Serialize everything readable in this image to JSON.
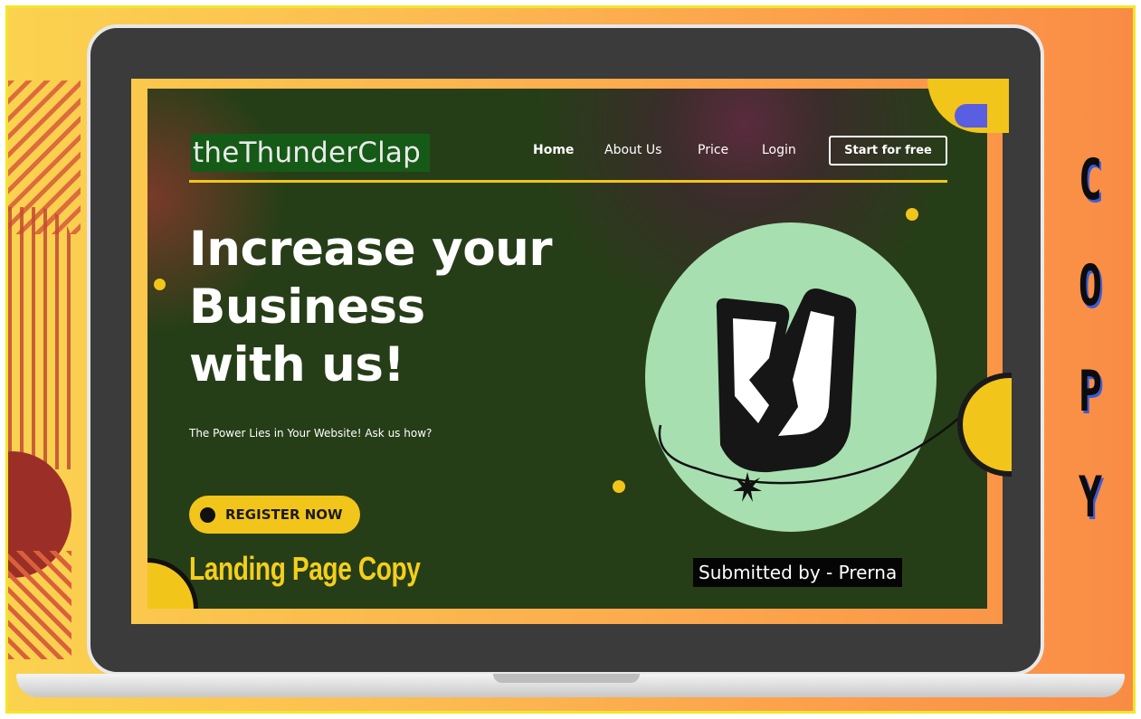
{
  "brand": {
    "logo_text": "theThunderClap"
  },
  "nav": {
    "items": [
      {
        "label": "Home"
      },
      {
        "label": "About Us"
      },
      {
        "label": "Price"
      },
      {
        "label": "Login"
      }
    ],
    "cta_label": "Start for free"
  },
  "hero": {
    "headline_lines": [
      "Increase your",
      "Business",
      "with us!"
    ],
    "tagline": "The Power Lies in Your Website! Ask us how?",
    "register_label": "REGISTER NOW"
  },
  "footer": {
    "title": "Landing Page Copy",
    "submitted": "Submitted by - Prerna"
  },
  "side_text": [
    "C",
    "O",
    "P",
    "Y"
  ],
  "colors": {
    "accent_yellow": "#f2c51a",
    "screen_bg": "#263e17",
    "logo_bg": "#155a16",
    "hero_circle": "#a8dfb0",
    "frame_orange": "#f98c45"
  },
  "icons": {
    "hero_logo": "thunderclap-logo-icon",
    "spark": "spark-star-icon"
  }
}
